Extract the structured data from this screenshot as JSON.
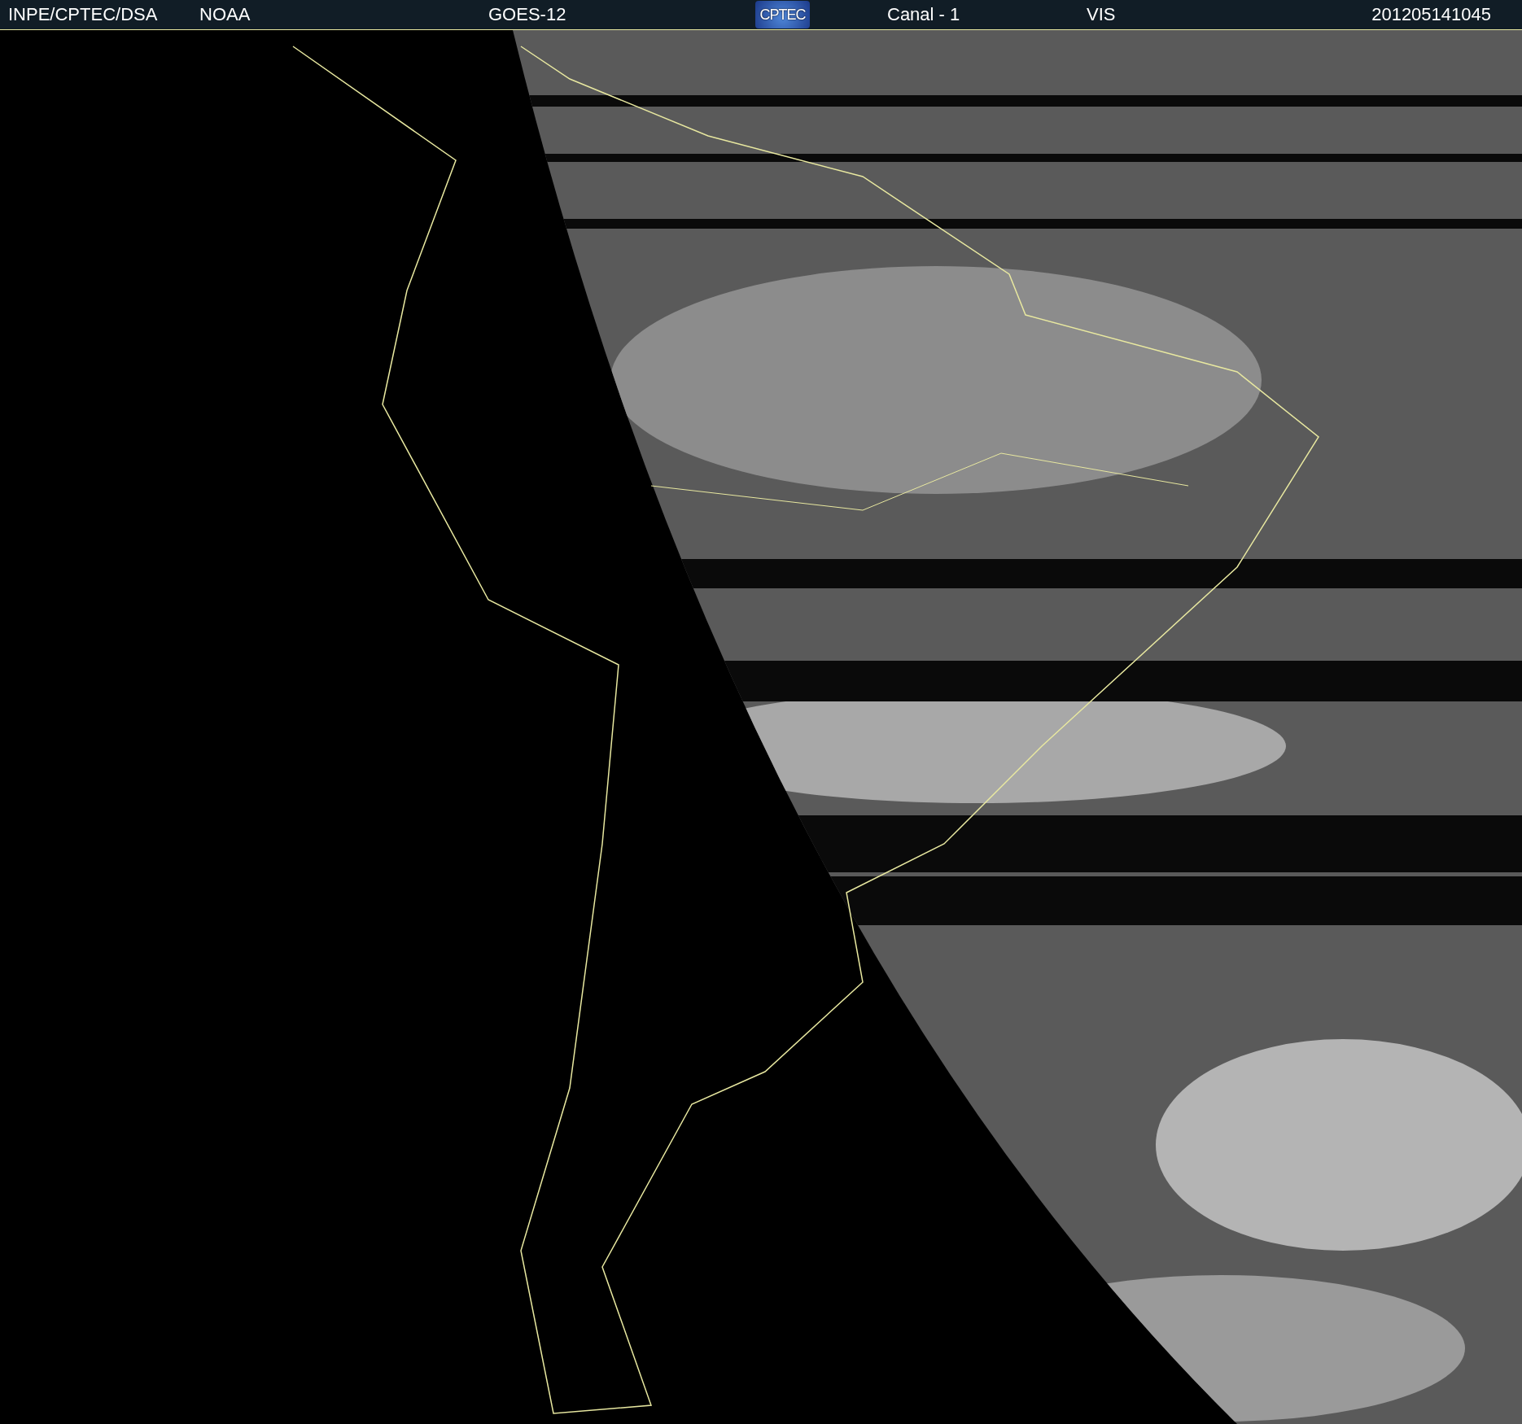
{
  "header": {
    "source": "INPE/CPTEC/DSA",
    "agency": "NOAA",
    "satellite": "GOES-12",
    "logo": "CPTEC",
    "channel": "Canal - 1",
    "band": "VIS",
    "timestamp": "201205141045"
  }
}
